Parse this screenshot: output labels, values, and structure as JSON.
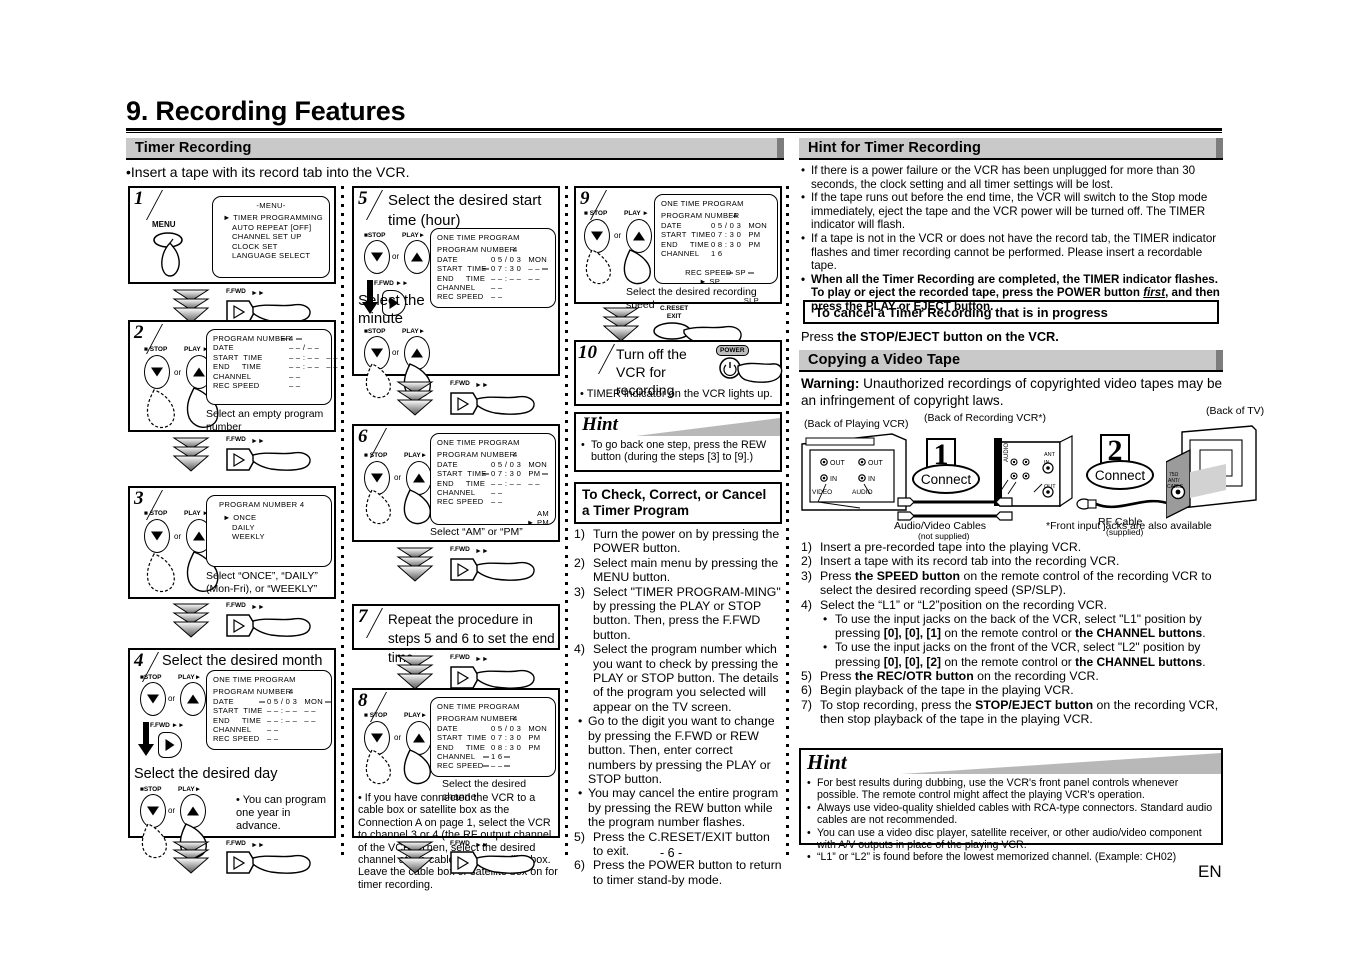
{
  "page": {
    "title": "9. Recording Features",
    "page_number": "- 6 -",
    "lang_mark": "EN"
  },
  "left": {
    "section_title": "Timer Recording",
    "intro": "•Insert a tape with its record tab into the VCR.",
    "steps": [
      {
        "num": "1",
        "title": "",
        "button_label": "MENU",
        "osd": {
          "title": "-MENU-",
          "lines": [
            "► TIMER PROGRAMMING",
            "AUTO REPEAT  [OFF]",
            "CHANNEL SET UP",
            "CLOCK SET",
            "LANGUAGE SELECT"
          ]
        }
      },
      {
        "num": "2",
        "osd_rows": [
          {
            "label": "PROGRAM NUMBER",
            "value": "4",
            "flash": true
          },
          {
            "label": "DATE",
            "value": "– – / – –"
          },
          {
            "label": "START  TIME",
            "value": "– – : – –   – –"
          },
          {
            "label": "END     TIME",
            "value": "– – : – –   – –"
          },
          {
            "label": "CHANNEL",
            "value": "– –"
          },
          {
            "label": "REC SPEED",
            "value": "– –"
          }
        ],
        "caption": "Select an empty program number"
      },
      {
        "num": "3",
        "osd": {
          "title": "PROGRAM  NUMBER  4",
          "lines": [
            "► ONCE",
            "DAILY",
            "WEEKLY"
          ]
        },
        "caption": "Select “ONCE”, “DAILY” (Mon-Fri), or “WEEKLY”"
      },
      {
        "num": "4",
        "title": "Select the desired month",
        "title2": "Select the desired day",
        "osd_title": "ONE TIME PROGRAM",
        "osd_rows": [
          {
            "label": "PROGRAM NUMBER",
            "value": "4"
          },
          {
            "label": "DATE",
            "value": "0 5 / 0 3   MON",
            "flash": true
          },
          {
            "label": "START  TIME",
            "value": "– – : – –   – –"
          },
          {
            "label": "END     TIME",
            "value": "– – : – –   – –"
          },
          {
            "label": "CHANNEL",
            "value": "– –"
          },
          {
            "label": "REC SPEED",
            "value": "– –"
          }
        ],
        "note": "• You can program one year in advance."
      }
    ],
    "connector_label": "F.FWD"
  },
  "mid": {
    "steps": [
      {
        "num": "5",
        "title": "Select the desired start time (hour)",
        "title2": "Select the minute",
        "osd_title": "ONE TIME PROGRAM",
        "osd_rows": [
          {
            "label": "PROGRAM NUMBER",
            "value": "4"
          },
          {
            "label": "DATE",
            "value": "0 5 / 0 3   MON"
          },
          {
            "label": "START  TIME",
            "value": "0 7 : 3 0   – –",
            "flash": true
          },
          {
            "label": "END     TIME",
            "value": "– – : – –   – –"
          },
          {
            "label": "CHANNEL",
            "value": "– –"
          },
          {
            "label": "REC SPEED",
            "value": "– –"
          }
        ]
      },
      {
        "num": "6",
        "osd_title": "ONE TIME PROGRAM",
        "osd_rows": [
          {
            "label": "PROGRAM NUMBER",
            "value": "4"
          },
          {
            "label": "DATE",
            "value": "0 5 / 0 3   MON"
          },
          {
            "label": "START  TIME",
            "value": "0 7 : 3 0   PM",
            "flash": true
          },
          {
            "label": "END     TIME",
            "value": "– – : – –   – –"
          },
          {
            "label": "CHANNEL",
            "value": "– –"
          },
          {
            "label": "REC SPEED",
            "value": "– –"
          }
        ],
        "osd_extra": [
          "AM",
          "► PM"
        ],
        "caption": "Select “AM” or “PM”"
      },
      {
        "num": "7",
        "title": "Repeat the procedure in steps 5 and 6 to set the end time."
      },
      {
        "num": "8",
        "osd_title": "ONE TIME PROGRAM",
        "osd_rows": [
          {
            "label": "PROGRAM NUMBER",
            "value": "4"
          },
          {
            "label": "DATE",
            "value": "0 5 / 0 3   MON"
          },
          {
            "label": "START  TIME",
            "value": "0 7 : 3 0   PM"
          },
          {
            "label": "END     TIME",
            "value": "0 8 : 3 0   PM"
          },
          {
            "label": "CHANNEL",
            "value": "1 6",
            "flash": true
          },
          {
            "label": "REC SPEED",
            "value": "– –",
            "flash": true
          }
        ],
        "caption": "Select the desired channel",
        "note": "• If you have connected the VCR to a cable box or satellite box as the Connection A on page 1, select the VCR to channel 3 or 4 (the RF output channel of the VCR). Then, select the desired channel at the cable box or satellite box. Leave the cable box or satellite box on for timer recording."
      }
    ]
  },
  "right_inner": {
    "steps": [
      {
        "num": "9",
        "osd_title": "ONE TIME PROGRAM",
        "osd_rows": [
          {
            "label": "PROGRAM NUMBER",
            "value": "4"
          },
          {
            "label": "DATE",
            "value": "0 5 / 0 3   MON"
          },
          {
            "label": "START  TIME",
            "value": "0 7 : 3 0   PM"
          },
          {
            "label": "END     TIME",
            "value": "0 8 : 3 0   PM"
          },
          {
            "label": "CHANNEL",
            "value": "1 6"
          },
          {
            "label": "REC SPEED",
            "value": "SP",
            "flash": true
          }
        ],
        "osd_extra": [
          "► SP",
          "SLP"
        ],
        "caption": "Select the desired recording speed"
      },
      {
        "num": "10",
        "title": "Turn off the VCR for recording",
        "button_label": "POWER",
        "note": "• TIMER indicator on the VCR lights up."
      }
    ],
    "connector_label": "C.RESET EXIT",
    "hint": {
      "word": "Hint",
      "items": [
        "To go back one step, press the REW button (during the steps [3] to [9].)"
      ]
    },
    "check_box": {
      "title": "To Check, Correct, or Cancel a Timer Program",
      "items": [
        {
          "n": "1)",
          "text": "Turn the power on by pressing the POWER button."
        },
        {
          "n": "2)",
          "text": "Select main menu by pressing the MENU button."
        },
        {
          "n": "3)",
          "text": "Select \"TIMER PROGRAM-MING\" by pressing the PLAY or STOP button. Then, press the F.FWD button."
        },
        {
          "n": "4)",
          "text": "Select the program number which you want to check by pressing the PLAY or STOP button. The details of the program you selected will appear on the TV screen."
        },
        {
          "n": "•",
          "text": "Go to the digit you want to change by pressing the F.FWD or REW button. Then, enter correct numbers by pressing the PLAY or STOP button."
        },
        {
          "n": "•",
          "text": "You may cancel the entire program by pressing the REW button while the program number flashes."
        },
        {
          "n": "5)",
          "text": "Press the C.RESET/EXIT button to exit."
        },
        {
          "n": "6)",
          "text": "Press the POWER button to return to timer stand-by mode."
        }
      ]
    }
  },
  "right": {
    "hint_timer": {
      "title": "Hint for Timer Recording",
      "bullets": [
        {
          "text": "If there is a power failure or the VCR has been unplugged for more than 30 seconds, the clock setting and all timer settings will be lost.",
          "bold": false
        },
        {
          "text": "If the tape runs out before the end time, the VCR will switch to the Stop mode immediately, eject the tape and the VCR power will be turned off. The TIMER indicator will flash.",
          "bold": false
        },
        {
          "text": "If a tape is not in the VCR or does not have the record tab, the TIMER indicator flashes and timer recording cannot be performed. Please insert a recordable tape.",
          "bold": false
        },
        {
          "text": "When all the Timer Recording are completed, the TIMER indicator flashes. To play or eject the recorded tape, press the POWER button first, and then press the PLAY or EJECT button.",
          "bold": true
        }
      ]
    },
    "cancel_box_title": "To cancel a Timer Recording that is in progress",
    "cancel_text_prefix": "Press ",
    "cancel_text_bold": "the STOP/EJECT button on the VCR.",
    "copying": {
      "title": "Copying a Video Tape",
      "warning_label": "Warning:",
      "warning_text": " Unauthorized recordings of copyrighted video tapes may be an infringement of copyright laws.",
      "diagram": {
        "label_playing": "(Back of Playing VCR)",
        "label_recording": "(Back of Recording VCR*)",
        "label_tv": "(Back of TV)",
        "badge1_num": "1",
        "badge1_text": "Connect",
        "badge2_num": "2",
        "badge2_text": "Connect",
        "av_cables": "Audio/Video Cables",
        "av_cables_sub": "(not supplied)",
        "rf_cable": "RF Cable",
        "rf_cable_sub": "(supplied)",
        "footnote": "*Front input jacks are also available",
        "jack_video": "VIDEO",
        "jack_audio": "AUDIO",
        "jack_out": "OUT",
        "jack_in": "IN",
        "ant_in": "ANT IN",
        "ant_out": "OUT",
        "tv_jack": "75Ω ANT/ CABLE"
      },
      "steps": [
        {
          "n": "1)",
          "parts": [
            {
              "t": "Insert a pre-recorded tape into the playing VCR.",
              "b": false
            }
          ]
        },
        {
          "n": "2)",
          "parts": [
            {
              "t": "Insert a tape with its record tab into the recording VCR.",
              "b": false
            }
          ]
        },
        {
          "n": "3)",
          "parts": [
            {
              "t": "Press ",
              "b": false
            },
            {
              "t": "the SPEED button",
              "b": true
            },
            {
              "t": " on the remote control of the recording VCR to select the desired recording speed (SP/SLP).",
              "b": false
            }
          ]
        },
        {
          "n": "4)",
          "parts": [
            {
              "t": "Select the “L1” or “L2”position on the recording VCR.",
              "b": false
            }
          ]
        }
      ],
      "substeps": [
        {
          "parts": [
            {
              "t": "To use the input jacks on the back of the VCR, select \"L1\" position by pressing ",
              "b": false
            },
            {
              "t": "[0], [0], [1]",
              "b": true
            },
            {
              "t": " on the remote control or ",
              "b": false
            },
            {
              "t": "the CHANNEL buttons",
              "b": true
            },
            {
              "t": ".",
              "b": false
            }
          ]
        },
        {
          "parts": [
            {
              "t": "To use the input jacks on the front of the VCR, select \"L2\" position by pressing ",
              "b": false
            },
            {
              "t": "[0], [0], [2]",
              "b": true
            },
            {
              "t": " on the remote control or ",
              "b": false
            },
            {
              "t": "the CHANNEL buttons",
              "b": true
            },
            {
              "t": ".",
              "b": false
            }
          ]
        }
      ],
      "steps_after": [
        {
          "n": "5)",
          "parts": [
            {
              "t": "Press ",
              "b": false
            },
            {
              "t": "the REC/OTR button",
              "b": true
            },
            {
              "t": " on the recording VCR.",
              "b": false
            }
          ]
        },
        {
          "n": "6)",
          "parts": [
            {
              "t": "Begin playback of the tape in the playing VCR.",
              "b": false
            }
          ]
        },
        {
          "n": "7)",
          "parts": [
            {
              "t": "To stop recording, press the ",
              "b": false
            },
            {
              "t": "STOP/EJECT button",
              "b": true
            },
            {
              "t": " on the recording VCR, then stop playback of the tape in the playing VCR.",
              "b": false
            }
          ]
        }
      ]
    },
    "hint_bottom": {
      "word": "Hint",
      "bullets": [
        "For best results during dubbing, use the VCR's front panel controls whenever possible. The remote control might affect the playing VCR's operation.",
        "Always use video-quality shielded cables with RCA-type connectors. Standard audio cables are not recommended.",
        "You can use a video disc player, satellite receiver, or other audio/video component with A/V outputs in place of the playing VCR.",
        "“L1” or “L2” is found before the lowest memorized channel.  (Example: CH02)"
      ]
    }
  },
  "colors": {
    "header_bg": "#c9c9c9",
    "header_endcap": "#7d7d7d",
    "ink": "#000000",
    "paper": "#ffffff"
  }
}
